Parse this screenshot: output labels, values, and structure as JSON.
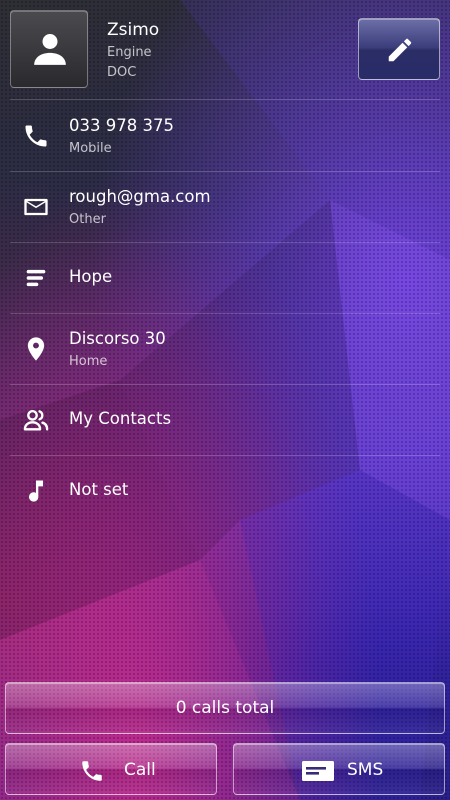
{
  "contact": {
    "name": "Zsimo",
    "organization": "Engine",
    "title": "DOC"
  },
  "details": {
    "phone": {
      "value": "033 978 375",
      "type": "Mobile"
    },
    "email": {
      "value": "rough@gma.com",
      "type": "Other"
    },
    "note": {
      "value": "Hope"
    },
    "address": {
      "value": "Discorso 30",
      "type": "Home"
    },
    "group": {
      "value": "My Contacts"
    },
    "ringtone": {
      "value": "Not set"
    }
  },
  "actions": {
    "calls_total": "0 calls total",
    "call_label": "Call",
    "sms_label": "SMS"
  },
  "icons": {
    "avatar": "person-icon",
    "edit": "pencil-icon",
    "phone": "phone-icon",
    "email": "mail-icon",
    "note": "note-icon",
    "address": "location-pin-icon",
    "group": "group-icon",
    "ringtone": "music-note-icon",
    "sms": "message-icon"
  },
  "colors": {
    "background_dark": "#2e2e34",
    "background_violet": "#4b2fb0",
    "background_magenta": "#d6288c",
    "text_primary": "#ffffff",
    "text_secondary": "#b8b8c8"
  }
}
